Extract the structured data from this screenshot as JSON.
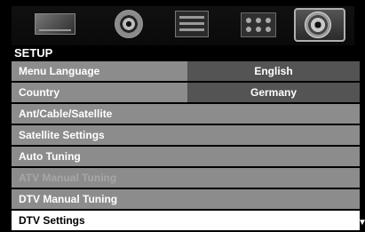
{
  "icon_bar": {
    "items": [
      "picture-icon",
      "sound-icon",
      "channel-list-icon",
      "setup-grid-icon",
      "settings-icon"
    ],
    "selected": "settings-icon"
  },
  "menu": {
    "title": "SETUP",
    "items": [
      {
        "label": "Menu Language",
        "value": "English",
        "state": "normal"
      },
      {
        "label": "Country",
        "value": "Germany",
        "state": "normal"
      },
      {
        "label": "Ant/Cable/Satellite",
        "state": "normal"
      },
      {
        "label": "Satellite Settings",
        "state": "normal"
      },
      {
        "label": "Auto Tuning",
        "state": "normal"
      },
      {
        "label": "ATV Manual Tuning",
        "state": "disabled"
      },
      {
        "label": "DTV Manual Tuning",
        "state": "normal"
      },
      {
        "label": "DTV Settings",
        "state": "selected"
      }
    ]
  },
  "colors": {
    "row_bg": "#8c8c8c",
    "value_bg": "#545454",
    "selected_bg": "#ffffff",
    "disabled_text": "#a6a6a6"
  }
}
